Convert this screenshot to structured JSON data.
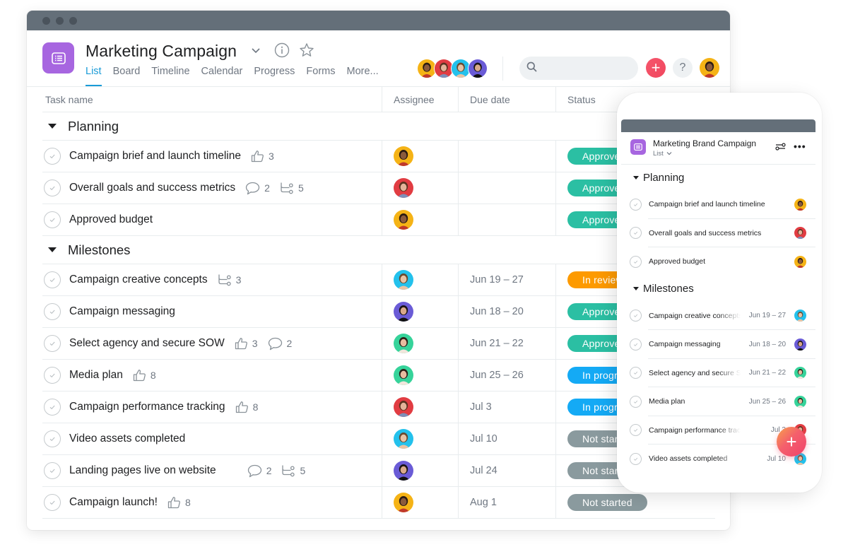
{
  "app": {
    "project_title": "Marketing Campaign",
    "tabs": [
      {
        "label": "List",
        "active": true
      },
      {
        "label": "Board",
        "active": false
      },
      {
        "label": "Timeline",
        "active": false
      },
      {
        "label": "Calendar",
        "active": false
      },
      {
        "label": "Progress",
        "active": false
      },
      {
        "label": "Forms",
        "active": false
      },
      {
        "label": "More...",
        "active": false
      }
    ],
    "search": {
      "placeholder": "",
      "value": ""
    },
    "help_label": "?",
    "add_label": "+"
  },
  "colors": {
    "accent": "#1a9bd7",
    "project_icon": "#a766e0",
    "approved": "#2bbfa3",
    "in_review": "#fd9a00",
    "in_progress": "#14aaf5",
    "not_started": "#8a9a9e"
  },
  "table": {
    "headers": {
      "task_name": "Task name",
      "assignee": "Assignee",
      "due_date": "Due date",
      "status": "Status"
    },
    "sections": [
      {
        "title": "Planning",
        "tasks": [
          {
            "name": "Campaign brief and launch timeline",
            "likes": "3",
            "comments": null,
            "subtasks": null,
            "assignee": "woman-yellow",
            "due": "",
            "status": "Approved"
          },
          {
            "name": "Overall goals and success metrics",
            "likes": null,
            "comments": "2",
            "subtasks": "5",
            "assignee": "woman-red",
            "due": "",
            "status": "Approved"
          },
          {
            "name": "Approved budget",
            "likes": null,
            "comments": null,
            "subtasks": null,
            "assignee": "woman-yellow",
            "due": "",
            "status": "Approved"
          }
        ]
      },
      {
        "title": "Milestones",
        "tasks": [
          {
            "name": "Campaign creative concepts",
            "likes": null,
            "comments": null,
            "subtasks": "3",
            "assignee": "man-blue",
            "due": "Jun 19 – 27",
            "status": "In review"
          },
          {
            "name": "Campaign messaging",
            "likes": null,
            "comments": null,
            "subtasks": null,
            "assignee": "woman-purple",
            "due": "Jun 18 – 20",
            "status": "Approved"
          },
          {
            "name": "Select agency and secure SOW",
            "likes": "3",
            "comments": "2",
            "subtasks": null,
            "assignee": "person-green",
            "due": "Jun 21 – 22",
            "status": "Approved"
          },
          {
            "name": "Media plan",
            "likes": "8",
            "comments": null,
            "subtasks": null,
            "assignee": "person-green",
            "due": "Jun 25 – 26",
            "status": "In progress"
          },
          {
            "name": "Campaign performance tracking",
            "likes": "8",
            "comments": null,
            "subtasks": null,
            "assignee": "woman-red",
            "due": "Jul 3",
            "status": "In progress"
          },
          {
            "name": "Video assets completed",
            "likes": null,
            "comments": null,
            "subtasks": null,
            "assignee": "man-blue",
            "due": "Jul 10",
            "status": "Not started"
          },
          {
            "name": "Landing pages live on website",
            "likes": null,
            "comments": "2",
            "subtasks": "5",
            "assignee": "woman-purple",
            "due": "Jul 24",
            "status": "Not started"
          },
          {
            "name": "Campaign launch!",
            "likes": "8",
            "comments": null,
            "subtasks": null,
            "assignee": "woman-yellow",
            "due": "Aug 1",
            "status": "Not started"
          }
        ]
      }
    ]
  },
  "mobile": {
    "project_title": "Marketing Brand Campaign",
    "view_label": "List",
    "sections": [
      {
        "title": "Planning",
        "tasks": [
          {
            "name": "Campaign brief and launch timeline",
            "due": "",
            "assignee": "woman-yellow"
          },
          {
            "name": "Overall goals and success metrics",
            "due": "",
            "assignee": "woman-red"
          },
          {
            "name": "Approved budget",
            "due": "",
            "assignee": "woman-yellow"
          }
        ]
      },
      {
        "title": "Milestones",
        "tasks": [
          {
            "name": "Campaign creative concepts",
            "due": "Jun 19 – 27",
            "assignee": "man-blue"
          },
          {
            "name": "Campaign messaging",
            "due": "Jun 18 – 20",
            "assignee": "woman-purple"
          },
          {
            "name": "Select agency and secure SOW",
            "due": "Jun 21 – 22",
            "assignee": "person-green"
          },
          {
            "name": "Media plan",
            "due": "Jun 25 – 26",
            "assignee": "person-green"
          },
          {
            "name": "Campaign performance tracking",
            "due": "Jul 3",
            "assignee": "woman-red"
          },
          {
            "name": "Video assets completed",
            "due": "Jul 10",
            "assignee": "man-blue"
          }
        ]
      }
    ],
    "fab_label": "+"
  },
  "members": [
    "woman-yellow",
    "woman-red",
    "man-blue",
    "woman-purple"
  ],
  "current_user": "woman-yellow"
}
